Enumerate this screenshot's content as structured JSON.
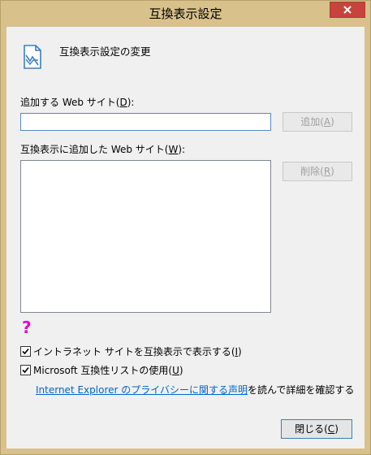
{
  "window": {
    "title": "互換表示設定"
  },
  "header": {
    "heading": "互換表示設定の変更"
  },
  "add_site": {
    "label_prefix": "追加する Web サイト(",
    "label_key": "D",
    "label_suffix": "):",
    "input_value": "",
    "button_prefix": "追加(",
    "button_key": "A",
    "button_suffix": ")"
  },
  "site_list": {
    "label_prefix": "互換表示に追加した Web サイト(",
    "label_key": "W",
    "label_suffix": "):",
    "items": [],
    "remove_prefix": "削除(",
    "remove_key": "R",
    "remove_suffix": ")"
  },
  "options": {
    "intranet_prefix": "イントラネット サイトを互換表示で表示する(",
    "intranet_key": "I",
    "intranet_suffix": ")",
    "intranet_checked": true,
    "mslist_prefix": "Microsoft 互換性リストの使用(",
    "mslist_key": "U",
    "mslist_suffix": ")",
    "mslist_checked": true
  },
  "privacy": {
    "link_text": "Internet Explorer のプライバシーに関する声明",
    "rest_text": "を読んで詳細を確認する"
  },
  "footer": {
    "close_prefix": "閉じる(",
    "close_key": "C",
    "close_suffix": ")"
  },
  "colors": {
    "frame": "#d9c18c",
    "close_button": "#c7443c",
    "help_icon": "#e300e3",
    "link": "#0066cc"
  }
}
